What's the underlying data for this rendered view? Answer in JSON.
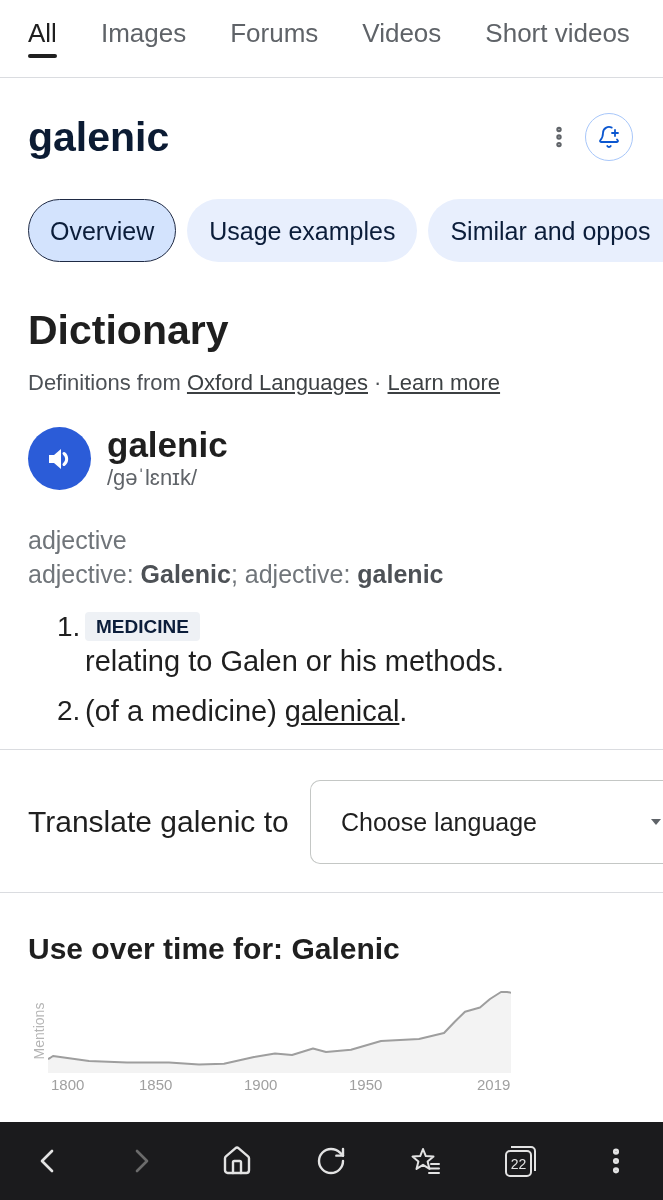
{
  "tabs": [
    {
      "label": "All",
      "selected": true
    },
    {
      "label": "Images",
      "selected": false
    },
    {
      "label": "Forums",
      "selected": false
    },
    {
      "label": "Videos",
      "selected": false
    },
    {
      "label": "Short videos",
      "selected": false
    }
  ],
  "header": {
    "title": "galenic"
  },
  "chips": [
    {
      "label": "Overview",
      "selected": true
    },
    {
      "label": "Usage examples",
      "selected": false
    },
    {
      "label": "Similar and oppos",
      "selected": false
    }
  ],
  "dictionary": {
    "heading": "Dictionary",
    "source": {
      "prefix": "Definitions from ",
      "source_link": "Oxford Languages",
      "separator": " · ",
      "learn_more": "Learn more"
    },
    "word": "galenic",
    "pronunciation": "/gəˈlɛnɪk/",
    "part_of_speech": "adjective",
    "forms": "adjective: **Galenic**; adjective: **galenic**",
    "definitions": [
      {
        "number": "1.",
        "tag": "MEDICINE",
        "text": "relating to Galen or his methods."
      },
      {
        "number": "2.",
        "text": "(of a medicine) ",
        "link": "galenical",
        "after": "."
      }
    ]
  },
  "translate": {
    "label": "Translate galenic to",
    "value": "Choose language"
  },
  "usage": {
    "title": "Use over time for: Galenic",
    "ylabel": "Mentions",
    "x_labels": [
      "1800",
      "1850",
      "1900",
      "1950",
      "2019"
    ]
  },
  "bottom_bar": {
    "back_disabled": false,
    "forward_disabled": true,
    "tab_count": "22"
  }
}
